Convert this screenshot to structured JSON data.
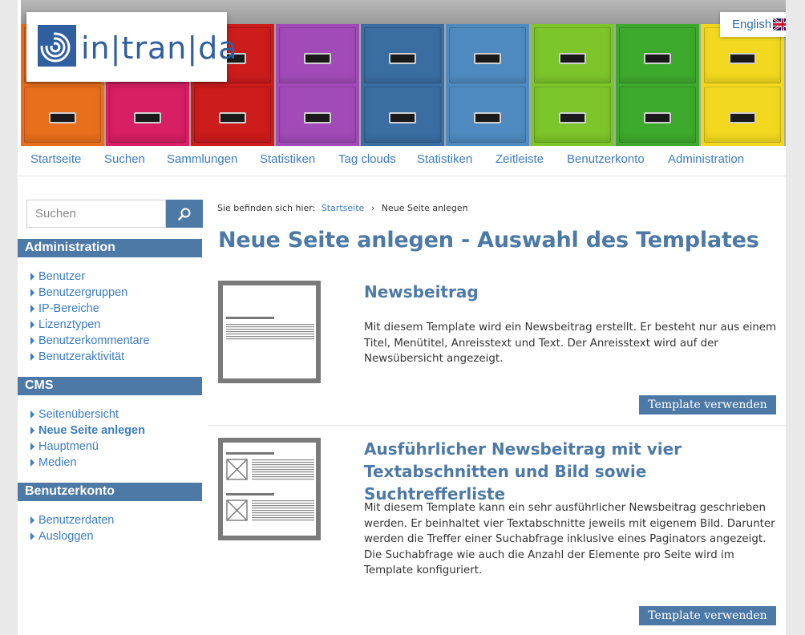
{
  "header": {
    "logo_text": "in|tran|da",
    "language": "English",
    "cabinet_colors": [
      "#e96f1c",
      "#d81f63",
      "#cc1c1c",
      "#a24bb8",
      "#3a6ea3",
      "#4f8bc0",
      "#7cc52a",
      "#3eaa2d",
      "#f2d91f"
    ]
  },
  "nav": {
    "items": [
      "Startseite",
      "Suchen",
      "Sammlungen",
      "Statistiken",
      "Tag clouds",
      "Statistiken",
      "Zeitleiste",
      "Benutzerkonto",
      "Administration"
    ]
  },
  "sidebar": {
    "search_placeholder": "Suchen",
    "sections": [
      {
        "title": "Administration",
        "items": [
          "Benutzer",
          "Benutzergruppen",
          "IP-Bereiche",
          "Lizenztypen",
          "Benutzerkommentare",
          "Benutzeraktivität"
        ]
      },
      {
        "title": "CMS",
        "items": [
          "Seitenübersicht",
          "Neue Seite anlegen",
          "Hauptmenü",
          "Medien"
        ],
        "active": "Neue Seite anlegen"
      },
      {
        "title": "Benutzerkonto",
        "items": [
          "Benutzerdaten",
          "Ausloggen"
        ]
      }
    ]
  },
  "breadcrumb": {
    "prefix": "Sie befinden sich hier:",
    "home": "Startseite",
    "separator": "›",
    "current": "Neue Seite anlegen"
  },
  "main": {
    "title": "Neue Seite anlegen - Auswahl des Templates",
    "templates": [
      {
        "name": "Newsbeitrag",
        "description": "Mit diesem Template wird ein Newsbeitrag erstellt. Er besteht nur aus einem Titel, Menütitel, Anreisstext und Text. Der Anreisstext wird auf der Newsübersicht angezeigt.",
        "button": "Template verwenden"
      },
      {
        "name": "Ausführlicher Newsbeitrag mit vier Textabschnitten und Bild sowie Suchtrefferliste",
        "description": "Mit diesem Template kann ein sehr ausführlicher Newsbeitrag geschrieben werden. Er beinhaltet vier Textabschnitte jeweils mit eigenem Bild. Darunter werden die Treffer einer Suchabfrage inklusive eines Paginators angezeigt. Die Suchabfrage wie auch die Anzahl der Elemente pro Seite wird im Template konfiguriert.",
        "button": "Template verwenden"
      }
    ]
  },
  "colors": {
    "accent": "#4d79a6",
    "link": "#3c7cc0"
  }
}
